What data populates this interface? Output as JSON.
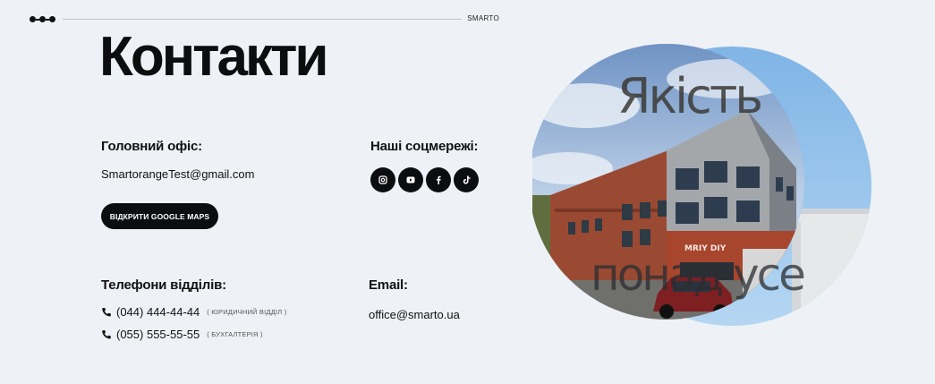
{
  "header": {
    "brand": "SMARTO"
  },
  "page": {
    "title": "Контакти"
  },
  "office": {
    "label": "Головний офіс:",
    "email": "SmartorangeTest@gmail.com",
    "maps_button": "ВІДКРИТИ GOOGLE MAPS"
  },
  "social": {
    "label": "Наші соцмережі:",
    "icons": [
      "instagram-icon",
      "youtube-icon",
      "facebook-icon",
      "tiktok-icon"
    ],
    "icon_glyphs": [
      "◘",
      "▶",
      "f",
      "♪"
    ]
  },
  "phones": {
    "label": "Телефони відділів:",
    "items": [
      {
        "number": "(044) 444-44-44",
        "note": "( ЮРИДИЧНИЙ ВІДДІЛ )"
      },
      {
        "number": "(055) 555-55-55",
        "note": "( БУХГАЛТЕРІЯ )"
      }
    ]
  },
  "email": {
    "label": "Email:",
    "value": "office@smarto.ua"
  },
  "hero": {
    "text_top": "Якість",
    "text_bottom": "понад усе",
    "building_sign": "MRIY DIY"
  },
  "colors": {
    "background": "#eef1f5",
    "dark": "#0c0d0f",
    "sky": "#8fbde6",
    "brick": "#9a4a32"
  }
}
